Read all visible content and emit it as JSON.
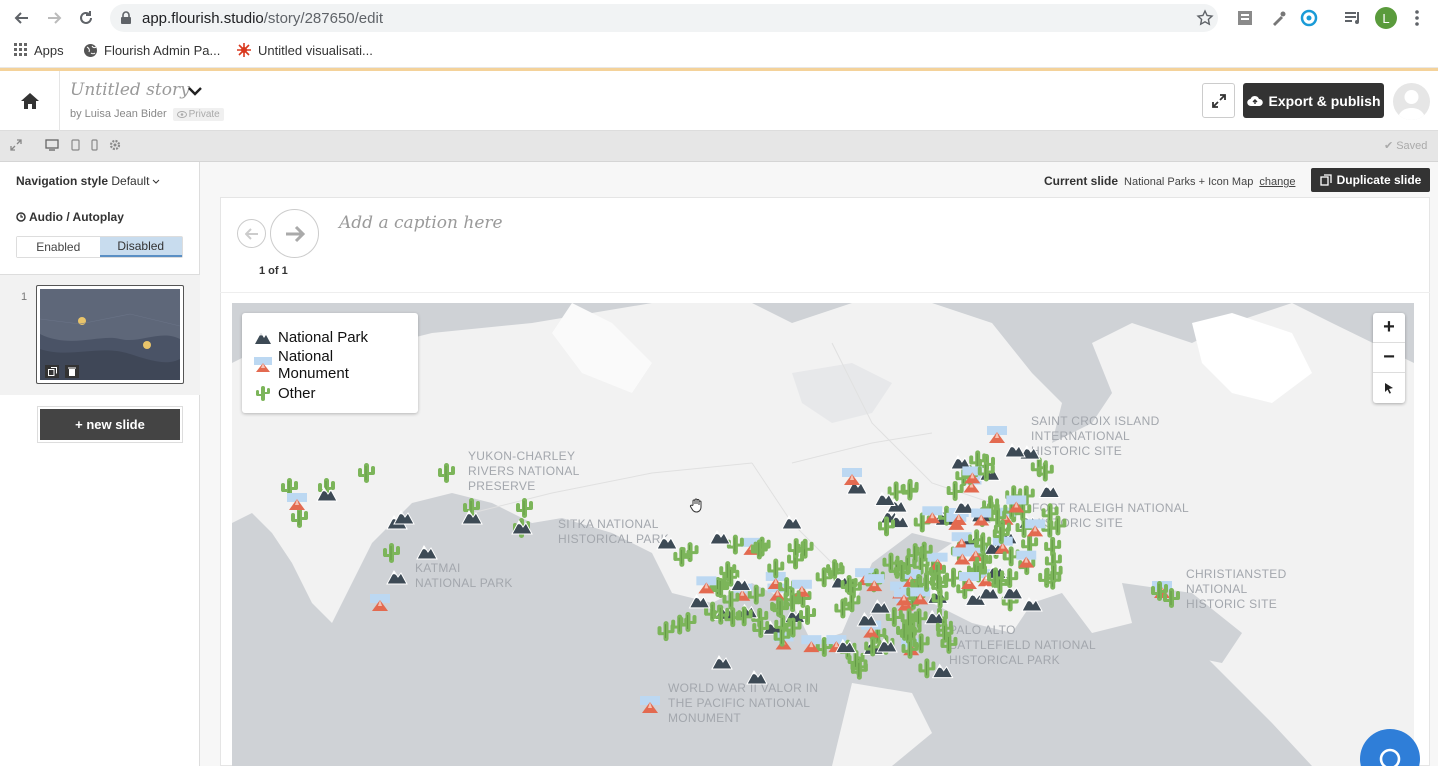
{
  "browser": {
    "url_host": "app.flourish.studio",
    "url_path": "/story/287650/edit",
    "bookmarks": [
      {
        "label": "Apps",
        "icon": "apps-grid-icon"
      },
      {
        "label": "Flourish Admin Pa...",
        "icon": "globe-icon"
      },
      {
        "label": "Untitled visualisati...",
        "icon": "flourish-logo-icon"
      }
    ],
    "profile_initial": "L"
  },
  "header": {
    "title_placeholder": "Untitled story",
    "byline": "by Luisa Jean Bider",
    "privacy": "Private",
    "export_label": "Export & publish"
  },
  "toolbar": {
    "saved_label": "Saved"
  },
  "sidebar": {
    "nav_style_label": "Navigation style",
    "nav_style_value": "Default",
    "audio_label": "Audio / Autoplay",
    "autoplay_options": [
      "Enabled",
      "Disabled"
    ],
    "autoplay_selected": "Disabled",
    "slides": [
      {
        "number": "1"
      }
    ],
    "new_slide_label": "+ new slide"
  },
  "main": {
    "current_slide_label": "Current slide",
    "current_slide_name": "National Parks + Icon Map",
    "change_label": "change",
    "duplicate_label": "Duplicate slide",
    "caption_placeholder": "Add a caption here",
    "page_indicator": "1 of 1"
  },
  "map": {
    "legend": [
      {
        "label": "National Park",
        "icon": "mountain-icon"
      },
      {
        "label": "National Monument",
        "icon": "monument-icon"
      },
      {
        "label": "Other",
        "icon": "cactus-icon"
      }
    ],
    "labels": [
      "YUKON-CHARLEY\nRIVERS NATIONAL\nPRESERVE",
      "SITKA NATIONAL\nHISTORICAL PARK",
      "KATMAI\nNATIONAL PARK",
      "SAINT CROIX ISLAND\nINTERNATIONAL\nHISTORIC SITE",
      "FORT RALEIGH NATIONAL\nHISTORIC SITE",
      "CHRISTIANSTED\nNATIONAL\nHISTORIC SITE",
      "PALO ALTO\nBATTLEFIELD NATIONAL\nHISTORICAL PARK",
      "WORLD WAR II VALOR IN\nTHE PACIFIC NATIONAL\nMONUMENT"
    ],
    "zoom_in": "+",
    "zoom_out": "−"
  },
  "colors": {
    "accent_bar": "#f4d29a",
    "dark_button": "#333333",
    "selected_segment": "#c8dcee",
    "map_water": "#cfd2d6",
    "map_land": "#f2f2f2",
    "park_icon": "#3d4a55",
    "cactus": "#7cb55a",
    "help_bubble": "#2f7ed8"
  }
}
